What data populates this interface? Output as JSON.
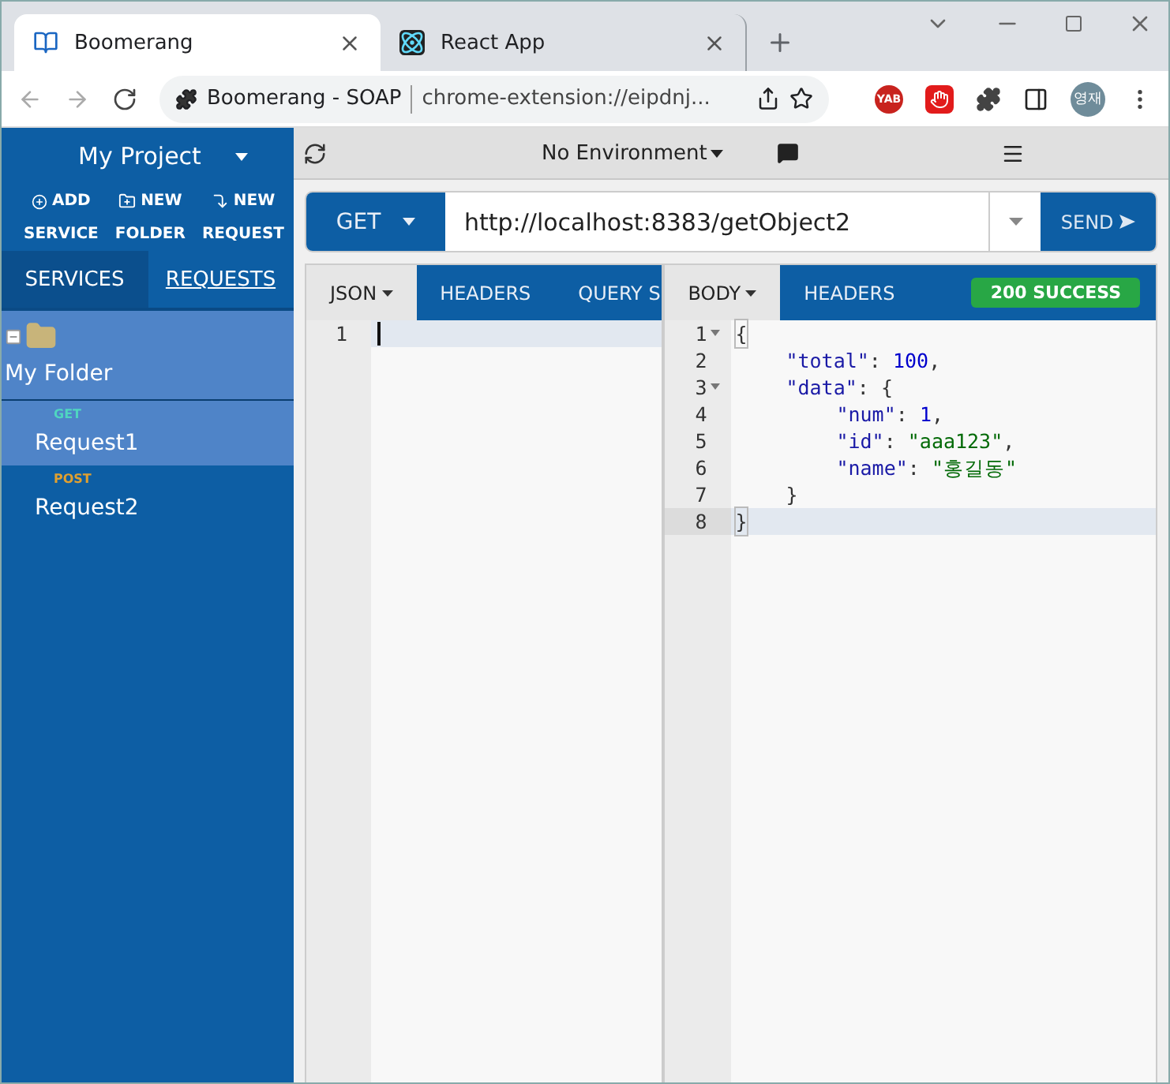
{
  "browser": {
    "tabs": [
      {
        "title": "Boomerang",
        "selected": true
      },
      {
        "title": "React App",
        "selected": false
      }
    ],
    "page_title": "Boomerang - SOAP",
    "url": "chrome-extension://eipdnj...",
    "extension_badge": "YAB",
    "profile": "영재"
  },
  "sidebar": {
    "project": "My Project",
    "actions": [
      {
        "label": "ADD",
        "sub": "SERVICE",
        "kind": "add"
      },
      {
        "label": "NEW",
        "sub": "FOLDER",
        "kind": "folder"
      },
      {
        "label": "NEW",
        "sub": "REQUEST",
        "kind": "request"
      }
    ],
    "tabs": [
      {
        "label": "SERVICES",
        "selected": false
      },
      {
        "label": "REQUESTS",
        "selected": true
      }
    ],
    "tree": [
      {
        "name": "My Folder",
        "expanded": true,
        "children": [
          {
            "method": "GET",
            "color": "#4fd6c0",
            "name": "Request1",
            "selected": true
          },
          {
            "method": "POST",
            "color": "#e0a030",
            "name": "Request2",
            "selected": false
          }
        ]
      }
    ]
  },
  "toolbar": {
    "environment": "No Environment"
  },
  "request": {
    "method": "GET",
    "url": "http://localhost:8383/getObject2",
    "send": "SEND",
    "tabs": [
      {
        "label": "JSON",
        "selected": true,
        "dropdown": true
      },
      {
        "label": "HEADERS",
        "selected": false,
        "dropdown": false
      },
      {
        "label": "QUERY S",
        "selected": false,
        "dropdown": false
      }
    ],
    "lines": [
      "1"
    ]
  },
  "response": {
    "tabs": [
      {
        "label": "BODY",
        "selected": true,
        "dropdown": true
      },
      {
        "label": "HEADERS",
        "selected": false,
        "dropdown": false
      }
    ],
    "status": "200 SUCCESS",
    "lines": [
      {
        "number": "1",
        "foldable": true,
        "active": false,
        "tokens": [
          {
            "text": "{",
            "kind": "bracket"
          }
        ]
      },
      {
        "number": "2",
        "foldable": false,
        "active": false,
        "tokens": [
          {
            "text": "\"total\"",
            "kind": "key"
          },
          {
            "text": ": ",
            "kind": "punct"
          },
          {
            "text": "100",
            "kind": "number"
          },
          {
            "text": ",",
            "kind": "punct"
          }
        ]
      },
      {
        "number": "3",
        "foldable": true,
        "active": false,
        "tokens": [
          {
            "text": "\"data\"",
            "kind": "key"
          },
          {
            "text": ": {",
            "kind": "punct"
          }
        ]
      },
      {
        "number": "4",
        "foldable": false,
        "active": false,
        "tokens": [
          {
            "text": "\"num\"",
            "kind": "key"
          },
          {
            "text": ": ",
            "kind": "punct"
          },
          {
            "text": "1",
            "kind": "number"
          },
          {
            "text": ",",
            "kind": "punct"
          }
        ]
      },
      {
        "number": "5",
        "foldable": false,
        "active": false,
        "tokens": [
          {
            "text": "\"id\"",
            "kind": "key"
          },
          {
            "text": ": ",
            "kind": "punct"
          },
          {
            "text": "\"aaa123\"",
            "kind": "string"
          },
          {
            "text": ",",
            "kind": "punct"
          }
        ]
      },
      {
        "number": "6",
        "foldable": false,
        "active": false,
        "tokens": [
          {
            "text": "\"name\"",
            "kind": "key"
          },
          {
            "text": ": ",
            "kind": "punct"
          },
          {
            "text": "\"홍길동\"",
            "kind": "string"
          }
        ]
      },
      {
        "number": "7",
        "foldable": false,
        "active": false,
        "tokens": [
          {
            "text": "}",
            "kind": "punct"
          }
        ]
      },
      {
        "number": "8",
        "foldable": false,
        "active": true,
        "tokens": [
          {
            "text": "}",
            "kind": "bracket"
          }
        ]
      }
    ]
  }
}
